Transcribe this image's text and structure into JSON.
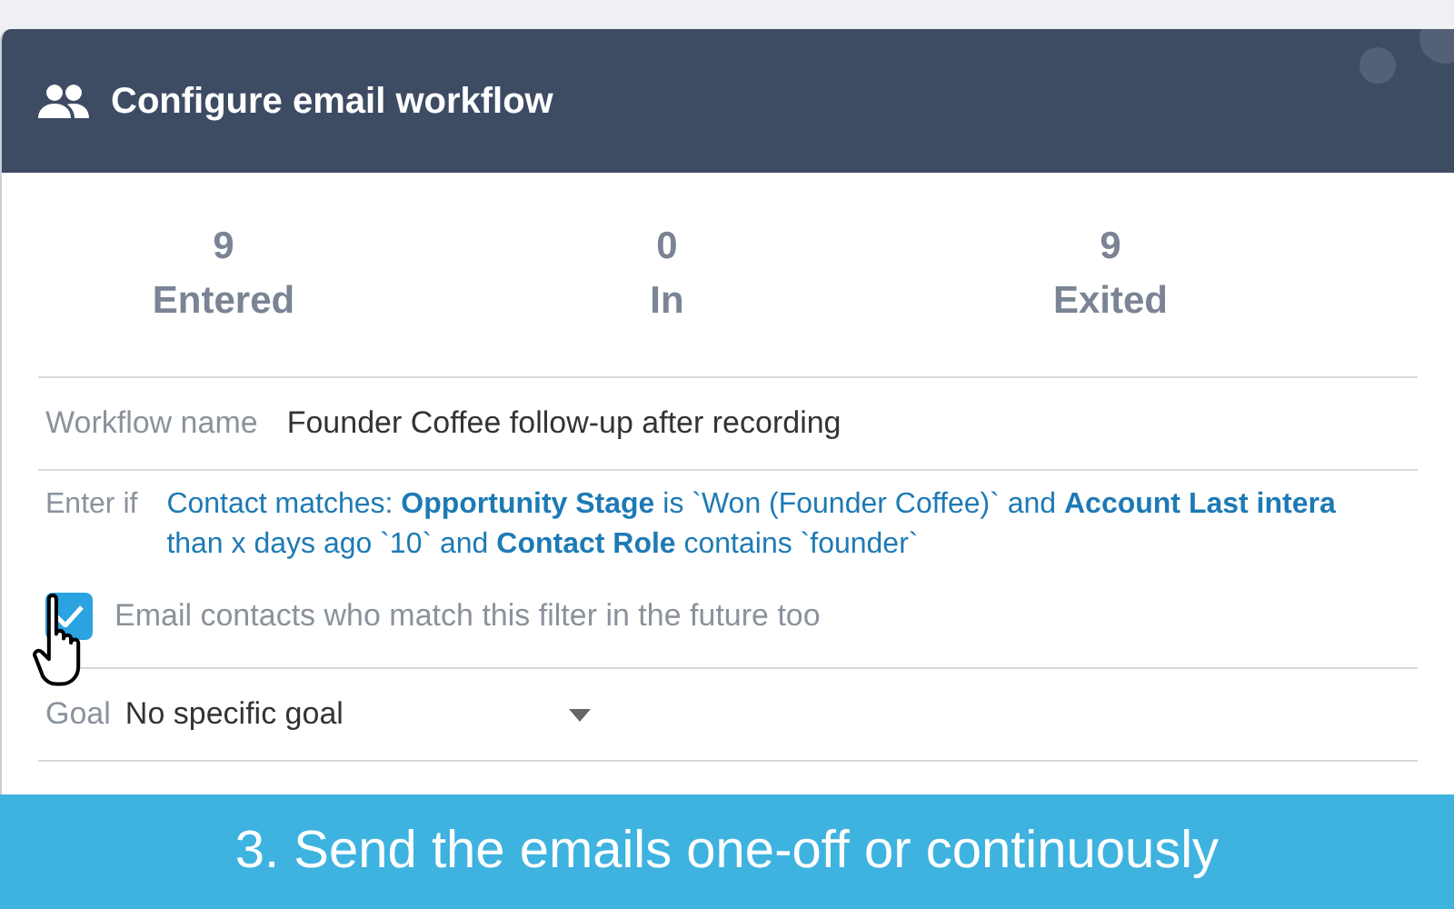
{
  "dialog": {
    "title": "Configure email workflow"
  },
  "stats": [
    {
      "value": "9",
      "label": "Entered"
    },
    {
      "value": "0",
      "label": "In"
    },
    {
      "value": "9",
      "label": "Exited"
    }
  ],
  "workflow_name": {
    "label": "Workflow name",
    "value": "Founder Coffee follow-up after recording"
  },
  "enter_if": {
    "label": "Enter if",
    "lines": [
      "Contact matches: **Opportunity Stage** is `Won (Founder Coffee)` and **Account Last intera**",
      "than x days ago `10` and **Contact Role** contains `founder`"
    ]
  },
  "future_contacts": {
    "label": "Email contacts who match this filter in the future too",
    "checked": true
  },
  "goal": {
    "label": "Goal",
    "value": "No specific goal"
  },
  "banner": {
    "text": "3. Send the emails one-off or continuously"
  }
}
